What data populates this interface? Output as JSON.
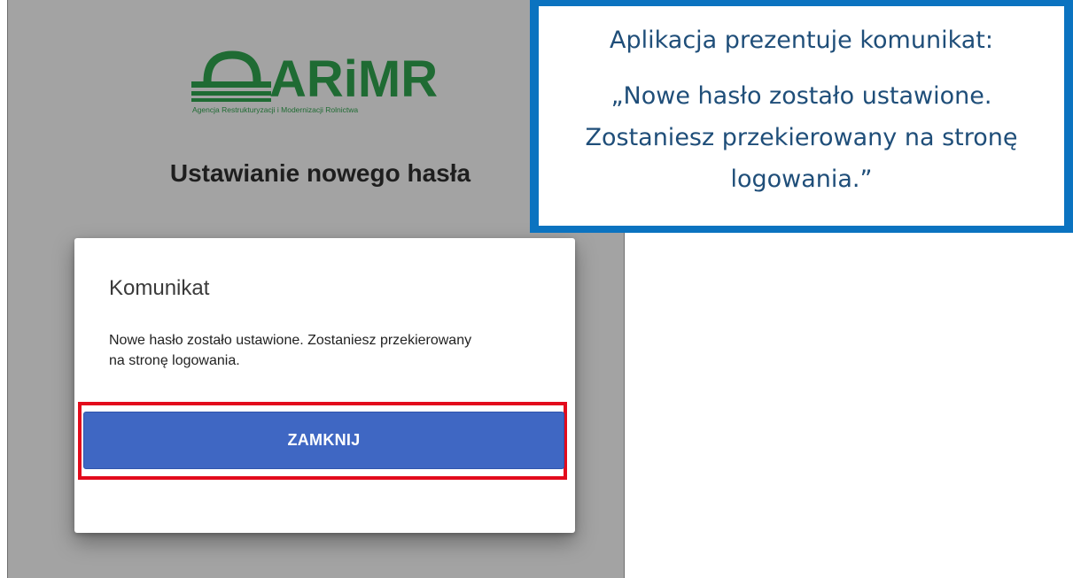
{
  "logo": {
    "wordmark": "ARiMR",
    "tagline": "Agencja Restrukturyzacji i Modernizacji Rolnictwa"
  },
  "page": {
    "heading": "Ustawianie nowego hasła"
  },
  "dialog": {
    "title": "Komunikat",
    "message": "Nowe hasło zostało ustawione. Zostaniesz przekierowany na stronę logowania.",
    "close_label": "ZAMKNIJ"
  },
  "callout": {
    "line1": "Aplikacja prezentuje komunikat:",
    "line2": "„Nowe hasło zostało ustawione.",
    "line3": "Zostaniesz przekierowany na stronę",
    "line4": "logowania.”"
  },
  "colors": {
    "brand_green": "#1f6b33",
    "button_blue": "#3f67c3",
    "highlight_red": "#e30b1c",
    "callout_border": "#0b73c0",
    "callout_text": "#1f4e79"
  }
}
